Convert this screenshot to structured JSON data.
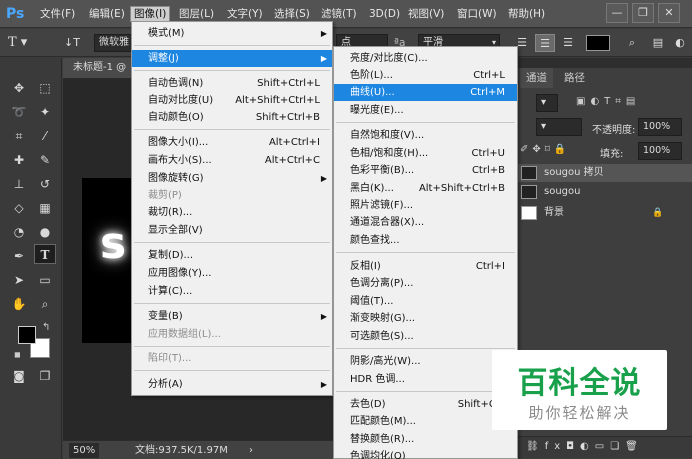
{
  "app": {
    "logo": "Ps"
  },
  "menubar": {
    "items": [
      "文件(F)",
      "编辑(E)",
      "图像(I)",
      "图层(L)",
      "文字(Y)",
      "选择(S)",
      "滤镜(T)",
      "3D(D)",
      "视图(V)",
      "窗口(W)",
      "帮助(H)"
    ],
    "active_index": 2
  },
  "window_controls": {
    "minimize": "—",
    "restore": "❐",
    "close": "✕"
  },
  "options": {
    "font_family": "微软雅",
    "font_size_fragment": "点",
    "aa_icon_text": "a",
    "antialias": "平滑"
  },
  "document": {
    "tab_title": "未标题-1 @",
    "canvas_text": "s",
    "zoom": "50%",
    "doc_size": "文档:937.5K/1.97M"
  },
  "panels": {
    "tabs": [
      "通道",
      "路径"
    ],
    "opacity_label": "不透明度:",
    "opacity_value": "100%",
    "fill_label": "填充:",
    "fill_value": "100%",
    "layers": [
      {
        "name": "sougou 拷贝"
      },
      {
        "name": "sougou"
      },
      {
        "name": "背景"
      }
    ]
  },
  "image_menu": {
    "items": [
      {
        "label": "模式(M)",
        "shortcut": "",
        "submenu": true,
        "disabled": false
      },
      {
        "label": "调整(J)",
        "shortcut": "",
        "submenu": true,
        "disabled": false,
        "highlighted": true
      },
      {
        "label": "自动色调(N)",
        "shortcut": "Shift+Ctrl+L",
        "disabled": false
      },
      {
        "label": "自动对比度(U)",
        "shortcut": "Alt+Shift+Ctrl+L",
        "disabled": false
      },
      {
        "label": "自动颜色(O)",
        "shortcut": "Shift+Ctrl+B",
        "disabled": false
      },
      {
        "label": "图像大小(I)...",
        "shortcut": "Alt+Ctrl+I",
        "disabled": false
      },
      {
        "label": "画布大小(S)...",
        "shortcut": "Alt+Ctrl+C",
        "disabled": false
      },
      {
        "label": "图像旋转(G)",
        "shortcut": "",
        "submenu": true,
        "disabled": false
      },
      {
        "label": "裁剪(P)",
        "shortcut": "",
        "disabled": true
      },
      {
        "label": "裁切(R)...",
        "shortcut": "",
        "disabled": false
      },
      {
        "label": "显示全部(V)",
        "shortcut": "",
        "disabled": false
      },
      {
        "label": "复制(D)...",
        "shortcut": "",
        "disabled": false
      },
      {
        "label": "应用图像(Y)...",
        "shortcut": "",
        "disabled": false
      },
      {
        "label": "计算(C)...",
        "shortcut": "",
        "disabled": false
      },
      {
        "label": "变量(B)",
        "shortcut": "",
        "submenu": true,
        "disabled": false
      },
      {
        "label": "应用数据组(L)...",
        "shortcut": "",
        "disabled": true
      },
      {
        "label": "陷印(T)...",
        "shortcut": "",
        "disabled": true
      },
      {
        "label": "分析(A)",
        "shortcut": "",
        "submenu": true,
        "disabled": false
      }
    ]
  },
  "adjust_menu": {
    "items": [
      {
        "label": "亮度/对比度(C)...",
        "shortcut": ""
      },
      {
        "label": "色阶(L)...",
        "shortcut": "Ctrl+L"
      },
      {
        "label": "曲线(U)...",
        "shortcut": "Ctrl+M",
        "highlighted": true
      },
      {
        "label": "曝光度(E)...",
        "shortcut": ""
      },
      {
        "label": "自然饱和度(V)...",
        "shortcut": ""
      },
      {
        "label": "色相/饱和度(H)...",
        "shortcut": "Ctrl+U"
      },
      {
        "label": "色彩平衡(B)...",
        "shortcut": "Ctrl+B"
      },
      {
        "label": "黑白(K)...",
        "shortcut": "Alt+Shift+Ctrl+B"
      },
      {
        "label": "照片滤镜(F)...",
        "shortcut": ""
      },
      {
        "label": "通道混合器(X)...",
        "shortcut": ""
      },
      {
        "label": "颜色查找...",
        "shortcut": ""
      },
      {
        "label": "反相(I)",
        "shortcut": "Ctrl+I"
      },
      {
        "label": "色调分离(P)...",
        "shortcut": ""
      },
      {
        "label": "阈值(T)...",
        "shortcut": ""
      },
      {
        "label": "渐变映射(G)...",
        "shortcut": ""
      },
      {
        "label": "可选颜色(S)...",
        "shortcut": ""
      },
      {
        "label": "阴影/高光(W)...",
        "shortcut": ""
      },
      {
        "label": "HDR 色调...",
        "shortcut": ""
      },
      {
        "label": "去色(D)",
        "shortcut": "Shift+Ctrl+"
      },
      {
        "label": "匹配颜色(M)...",
        "shortcut": ""
      },
      {
        "label": "替换颜色(R)...",
        "shortcut": ""
      },
      {
        "label": "色调均化(Q)",
        "shortcut": ""
      }
    ]
  },
  "watermark": {
    "title": "百科全说",
    "subtitle": "助你轻松解决"
  },
  "colors": {
    "highlight": "#1c86e0",
    "watermark_green": "#18a04b"
  }
}
